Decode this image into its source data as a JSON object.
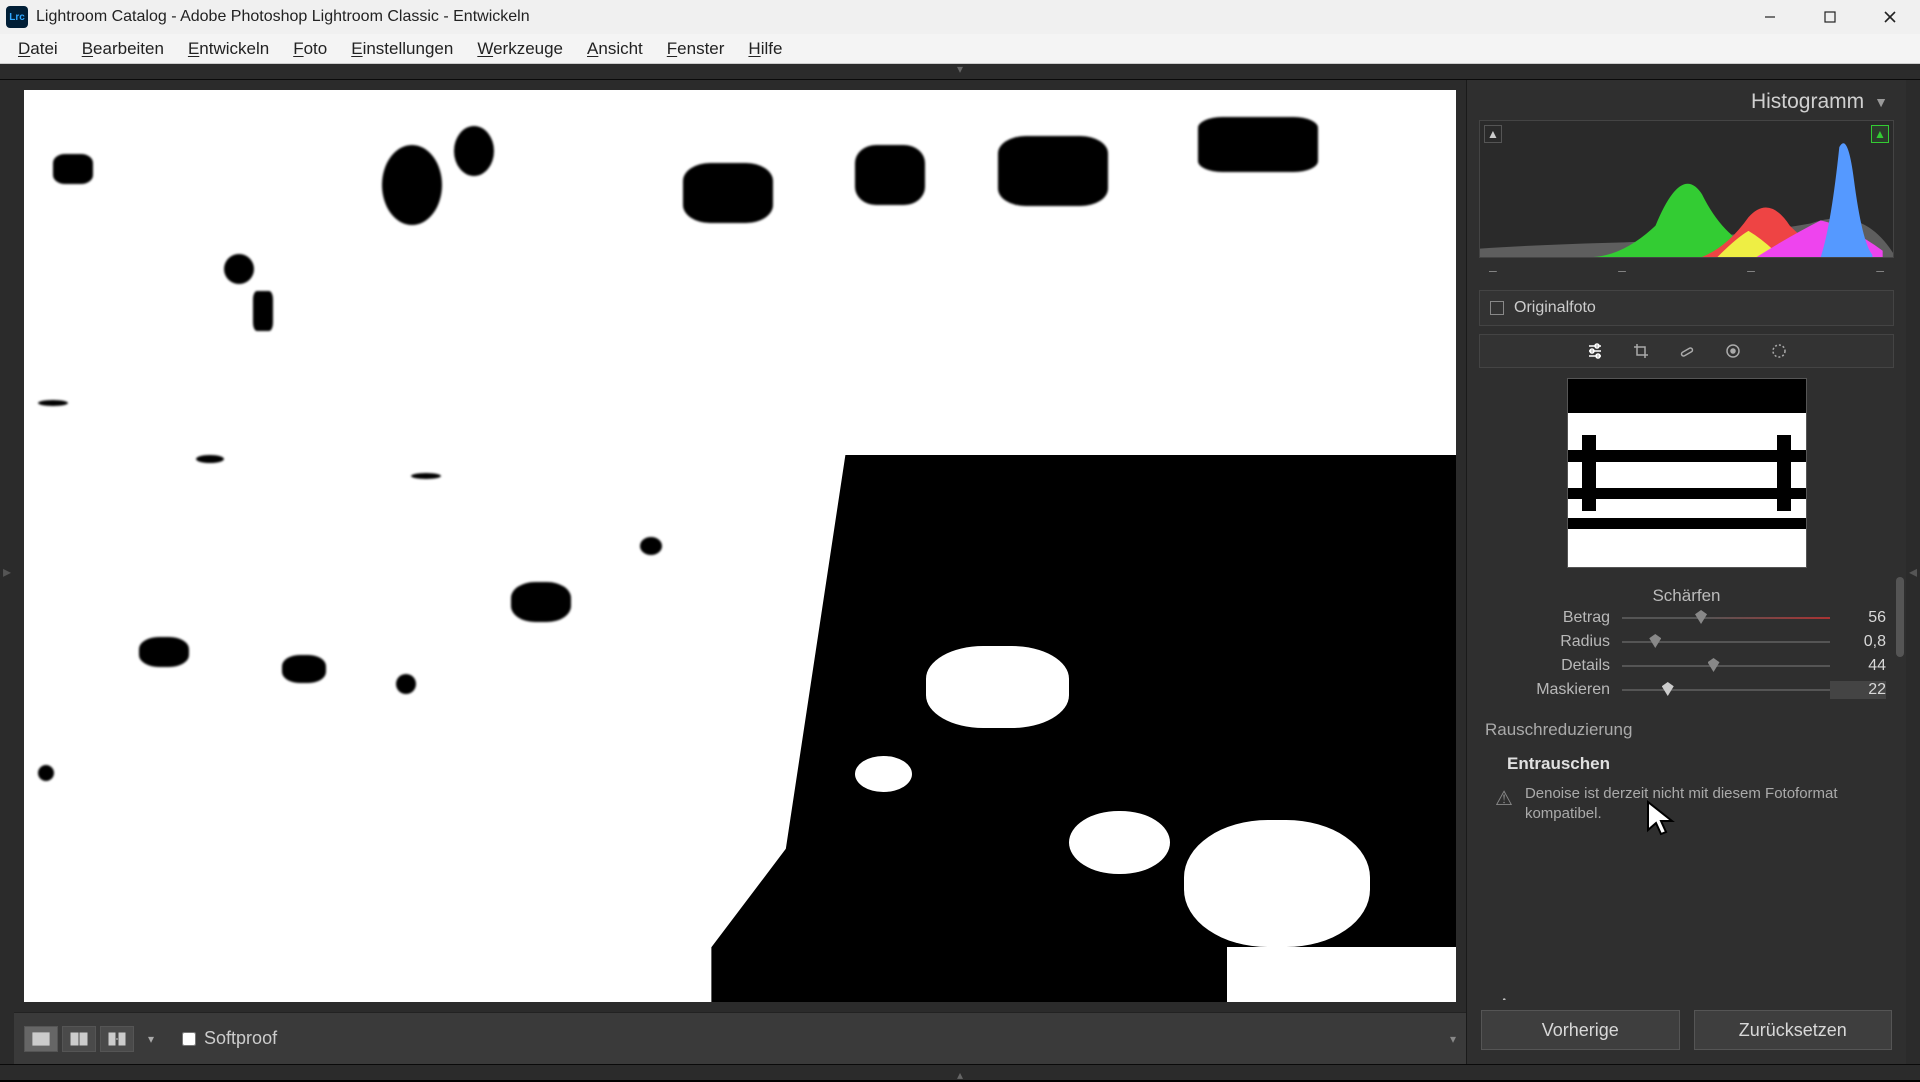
{
  "titlebar": {
    "app_short": "Lrc",
    "title": "Lightroom Catalog - Adobe Photoshop Lightroom Classic - Entwickeln"
  },
  "menubar": {
    "items": [
      {
        "label": "Datei",
        "ukey": "D"
      },
      {
        "label": "Bearbeiten",
        "ukey": "B"
      },
      {
        "label": "Entwickeln",
        "ukey": "E"
      },
      {
        "label": "Foto",
        "ukey": "F"
      },
      {
        "label": "Einstellungen",
        "ukey": "E"
      },
      {
        "label": "Werkzeuge",
        "ukey": "W"
      },
      {
        "label": "Ansicht",
        "ukey": "A"
      },
      {
        "label": "Fenster",
        "ukey": "F"
      },
      {
        "label": "Hilfe",
        "ukey": "H"
      }
    ]
  },
  "right_panel": {
    "histogram": {
      "title": "Histogramm",
      "meta": [
        "–",
        "–",
        "–",
        "–"
      ]
    },
    "original": {
      "label": "Originalfoto"
    },
    "tools": [
      {
        "name": "edit",
        "icon": "sliders-icon"
      },
      {
        "name": "crop",
        "icon": "crop-icon"
      },
      {
        "name": "heal",
        "icon": "heal-icon"
      },
      {
        "name": "redeye",
        "icon": "redeye-icon"
      },
      {
        "name": "mask",
        "icon": "mask-icon"
      }
    ],
    "sharpen": {
      "title": "Schärfen",
      "sliders": [
        {
          "label": "Betrag",
          "value": "56",
          "pos": 38,
          "colored": true
        },
        {
          "label": "Radius",
          "value": "0,8",
          "pos": 16,
          "colored": false
        },
        {
          "label": "Details",
          "value": "44",
          "pos": 44,
          "colored": false
        },
        {
          "label": "Maskieren",
          "value": "22",
          "pos": 22,
          "colored": false,
          "active": true
        }
      ]
    },
    "noise": {
      "title": "Rauschreduzierung",
      "denoise_label": "Entrauschen",
      "denoise_msg": "Denoise ist derzeit nicht mit diesem Fotoformat kompatibel."
    },
    "buttons": {
      "prev": "Vorherige",
      "reset": "Zurücksetzen"
    }
  },
  "bottombar": {
    "softproof_label": "Softproof"
  }
}
